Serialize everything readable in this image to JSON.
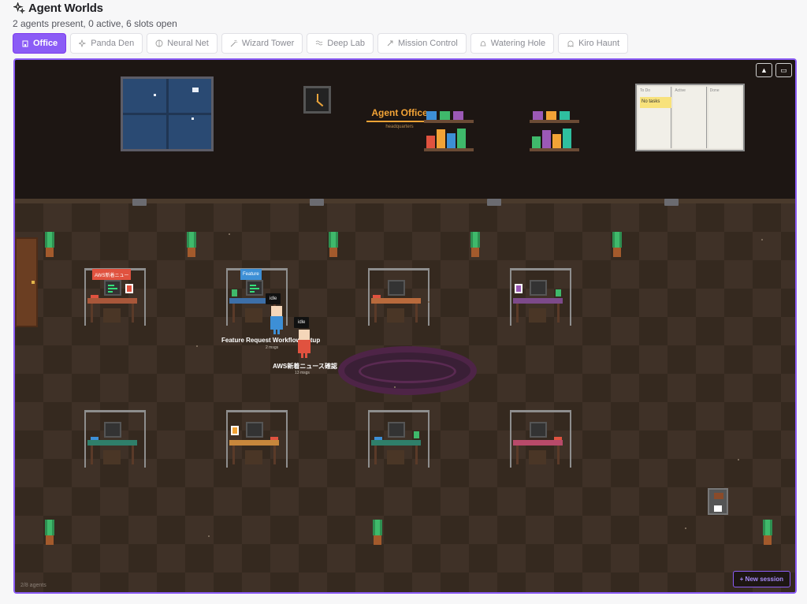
{
  "header": {
    "title": "Agent Worlds",
    "subtitle": "2 agents present, 0 active, 6 slots open"
  },
  "tabs": [
    {
      "label": "Office",
      "icon": "building-icon",
      "active": true
    },
    {
      "label": "Panda Den",
      "icon": "sparkles-icon",
      "active": false
    },
    {
      "label": "Neural Net",
      "icon": "brain-icon",
      "active": false
    },
    {
      "label": "Wizard Tower",
      "icon": "wand-icon",
      "active": false
    },
    {
      "label": "Deep Lab",
      "icon": "waves-icon",
      "active": false
    },
    {
      "label": "Mission Control",
      "icon": "rocket-icon",
      "active": false
    },
    {
      "label": "Watering Hole",
      "icon": "bell-icon",
      "active": false
    },
    {
      "label": "Kiro Haunt",
      "icon": "ghost-icon",
      "active": false
    }
  ],
  "office": {
    "sign_title": "Agent Office",
    "sign_subtitle": "headquarters",
    "board": {
      "columns": [
        "To Do",
        "Active",
        "Done"
      ],
      "sticky": "No tasks"
    },
    "desk_labels": [
      "AWS新着ニュー",
      "Feature"
    ],
    "agents": [
      {
        "status": "idle",
        "name": "Feature Request Workflow Setup",
        "messages": "2 msgs",
        "color": "#3d8fd6"
      },
      {
        "status": "idle",
        "name": "AWS新着ニュース確認",
        "messages": "13 msgs",
        "color": "#e0523f"
      }
    ],
    "agent_count": "2/8 agents",
    "new_session_label": "+ New session"
  },
  "colors": {
    "accent": "#8b5cf6",
    "agent_blue": "#3d8fd6",
    "agent_red": "#e0523f"
  }
}
